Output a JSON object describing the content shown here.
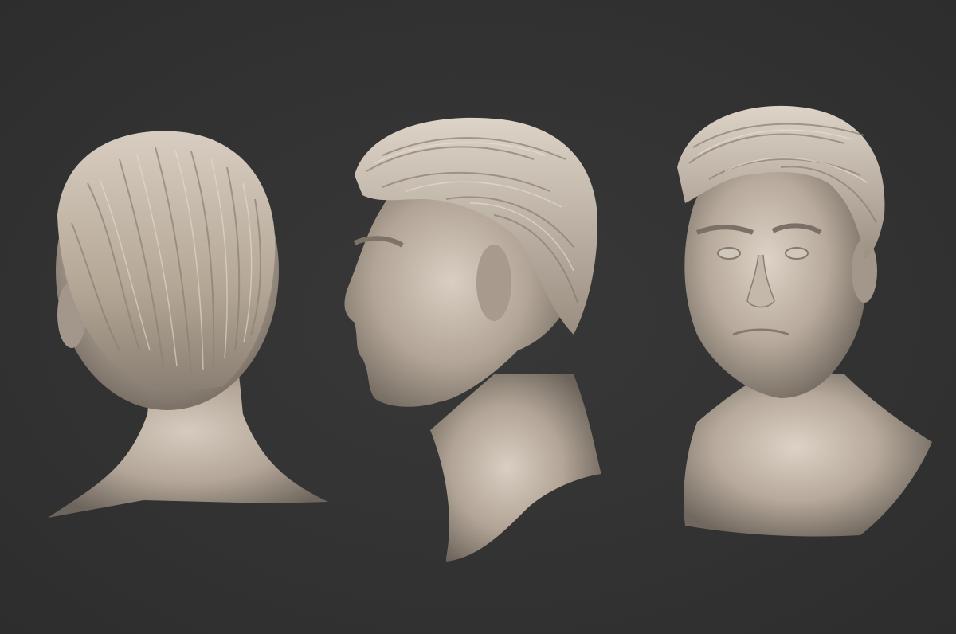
{
  "scene": {
    "background_color": "#333333",
    "material_color": "#b8ab9e",
    "material_shadow": "#6f665d",
    "material_highlight": "#e2d8cd",
    "views": [
      {
        "view": "back"
      },
      {
        "view": "side-left-profile"
      },
      {
        "view": "front-three-quarter"
      }
    ]
  }
}
